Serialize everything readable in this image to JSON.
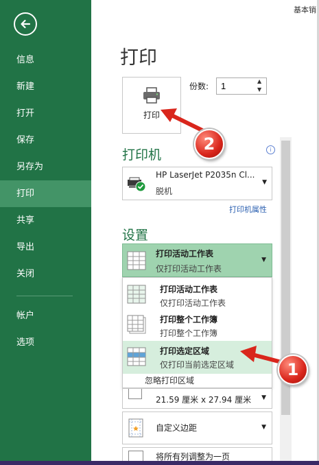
{
  "window": {
    "title_right": "基本销"
  },
  "sidebar": {
    "items": [
      {
        "label": "信息"
      },
      {
        "label": "新建"
      },
      {
        "label": "打开"
      },
      {
        "label": "保存"
      },
      {
        "label": "另存为"
      },
      {
        "label": "打印",
        "active": true
      },
      {
        "label": "共享"
      },
      {
        "label": "导出"
      },
      {
        "label": "关闭"
      },
      {
        "label": "帐户"
      },
      {
        "label": "选项"
      }
    ]
  },
  "main": {
    "title": "打印",
    "print_button_label": "打印",
    "copies": {
      "label": "份数:",
      "value": "1"
    },
    "printer_section": {
      "title": "打印机",
      "name": "HP LaserJet P2035n Cl...",
      "status": "脱机",
      "properties_link": "打印机属性"
    },
    "settings_section": {
      "title": "设置",
      "selected": {
        "title": "打印活动工作表",
        "subtitle": "仅打印活动工作表"
      },
      "options": [
        {
          "title": "打印活动工作表",
          "subtitle": "仅打印活动工作表"
        },
        {
          "title": "打印整个工作簿",
          "subtitle": "打印整个工作簿"
        },
        {
          "title": "打印选定区域",
          "subtitle": "仅打印当前选定区域"
        }
      ],
      "ignore_print_area": "忽略打印区域",
      "paper_size": "21.59 厘米 x 27.94 厘米",
      "margins": "自定义边距",
      "scaling": "将所有列调整为一页"
    }
  },
  "annotations": {
    "badge_1": "1",
    "badge_2": "2"
  },
  "colors": {
    "accent": "#217346",
    "active_nav": "#439467",
    "link": "#2a5fb0",
    "badge": "#d9261c"
  }
}
